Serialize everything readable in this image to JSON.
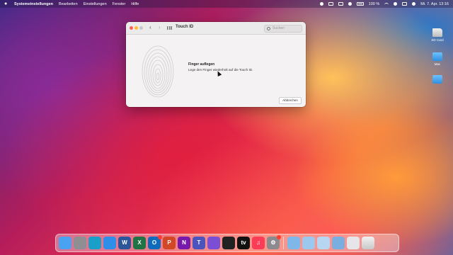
{
  "menubar": {
    "app_name": "Systemeinstellungen",
    "items": [
      "Bearbeiten",
      "Einstellungen",
      "Fenster",
      "Hilfe"
    ],
    "battery_text": "100 %",
    "clock": "Mi. 7. Apr. 13:16"
  },
  "window": {
    "title": "Touch ID",
    "search_placeholder": "Suchen",
    "heading": "Finger auflegen",
    "body": "Lege den Finger wiederholt auf die Touch ID.",
    "cancel_label": "Abbrechen"
  },
  "desktop_icons": [
    {
      "label": "SD Card",
      "icon": "sd-card-icon"
    },
    {
      "label": "Mac",
      "icon": "folder-icon"
    },
    {
      "label": "",
      "icon": "folder-icon"
    }
  ],
  "dock": {
    "apps": [
      {
        "name": "finder",
        "color": "#4aa3f0",
        "text": ""
      },
      {
        "name": "launchpad",
        "color": "#8e8e93",
        "text": ""
      },
      {
        "name": "edge",
        "color": "#1aa0c8",
        "text": ""
      },
      {
        "name": "safari",
        "color": "#2f8fe8",
        "text": ""
      },
      {
        "name": "word",
        "color": "#2b579a",
        "text": "W"
      },
      {
        "name": "excel",
        "color": "#217346",
        "text": "X"
      },
      {
        "name": "outlook",
        "color": "#0f6cbd",
        "text": "O"
      },
      {
        "name": "powerpoint",
        "color": "#d24726",
        "text": "P"
      },
      {
        "name": "onenote",
        "color": "#7719aa",
        "text": "N"
      },
      {
        "name": "teams",
        "color": "#4b53bc",
        "text": "T"
      },
      {
        "name": "affinity",
        "color": "#7a4fd6",
        "text": ""
      },
      {
        "name": "final-cut",
        "color": "#222222",
        "text": ""
      },
      {
        "name": "apple-tv",
        "color": "#111111",
        "text": "tv"
      },
      {
        "name": "music",
        "color": "#fa3c57",
        "text": "♫"
      },
      {
        "name": "system-preferences",
        "color": "#8a8a8f",
        "text": "⚙"
      }
    ],
    "stack_colors": [
      "#7fb8e8",
      "#9cc8ee",
      "#b7d6f1",
      "#7aaee0",
      "#e5e5ea"
    ]
  }
}
